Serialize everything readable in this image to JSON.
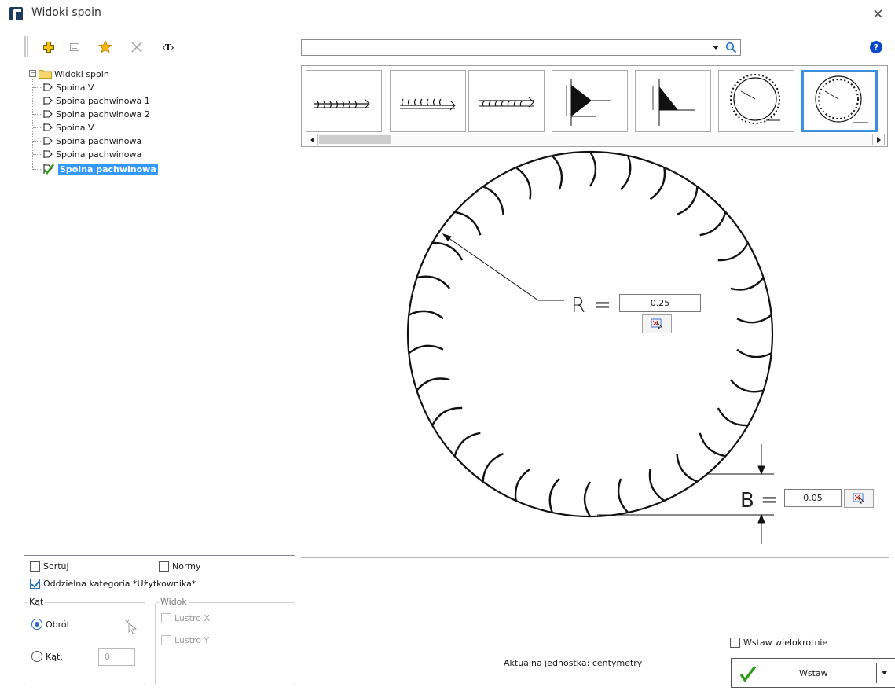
{
  "window": {
    "title": "Widoki spoin",
    "close_glyph": "×"
  },
  "toolbar": {
    "buttons": [
      {
        "name": "add-icon",
        "color": "#f5c400"
      },
      {
        "name": "properties-icon",
        "color": "#9a9a9a"
      },
      {
        "name": "favorite-star-icon",
        "color": "#f5a000"
      },
      {
        "name": "delete-icon",
        "color": "#b0b0b0"
      },
      {
        "name": "text-tag-icon",
        "label": "‹T›"
      }
    ],
    "search_value": "",
    "help_glyph": "?"
  },
  "tree": {
    "root": "Widoki spoin",
    "items": [
      "Spoina V",
      "Spoina pachwinowa 1",
      "Spoina pachwinowa 2",
      "Spoina V",
      "Spoina pachwinowa",
      "Spoina pachwinowa",
      "Spoina pachwinowa"
    ],
    "selected_index": 6
  },
  "thumbnails": {
    "items": [
      "weld-seam-line-1",
      "weld-seam-line-2",
      "weld-seam-line-3",
      "fillet-weld-1",
      "fillet-weld-2",
      "circular-weld-1",
      "circular-weld-2"
    ],
    "selected_index": 6
  },
  "preview": {
    "r_label": "R",
    "r_value": "0.25",
    "b_label": "B",
    "b_value": "0.05",
    "equals": "="
  },
  "options": {
    "sortuj": {
      "label": "Sortuj",
      "checked": false
    },
    "normy": {
      "label": "Normy",
      "checked": false
    },
    "oddzielna": {
      "label": "Oddzielna kategoria *Użytkownika*",
      "checked": true
    },
    "kat_group": {
      "title": "Kąt",
      "obrot_label": "Obrót",
      "kat_label": "Kąt:",
      "kat_value": "0",
      "selected": "obrot"
    },
    "widok_group": {
      "title": "Widok",
      "lustro_x": "Lustro X",
      "lustro_y": "Lustro Y"
    },
    "wstaw_wielokrotnie": {
      "label": "Wstaw wielokrotnie",
      "checked": false
    }
  },
  "status": {
    "unit_text": "Aktualna jednostka: centymetry"
  },
  "insert_button": {
    "label": "Wstaw",
    "accent": "#2e9c1a"
  }
}
